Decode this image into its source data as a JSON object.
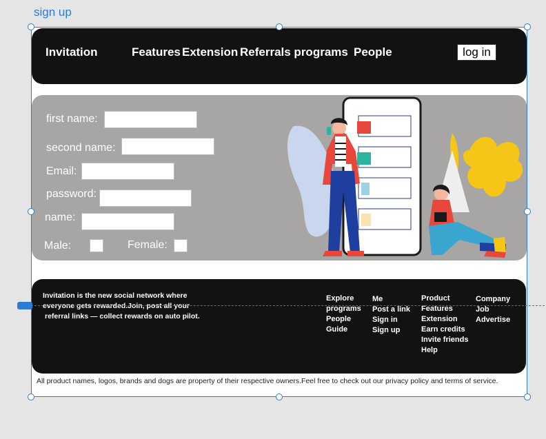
{
  "frame": {
    "label": "sign up"
  },
  "header": {
    "brand": "Invitation",
    "nav": [
      "Features",
      "Extension",
      "Referrals programs",
      "People"
    ],
    "login_label": "log in"
  },
  "form": {
    "first_name_label": "first name:",
    "second_name_label": "second name:",
    "email_label": "Email:",
    "password_label": "password:",
    "name_label": "name:",
    "male_label": "Male:",
    "female_label": "Female:"
  },
  "footer": {
    "about_lines": [
      "Invitation is the new social network where",
      "everyone gets rewarded.Join, post all your",
      "referral links — collect rewards on auto pilot."
    ],
    "col1": [
      "Explore",
      "programs",
      "People",
      "Guide"
    ],
    "col2": [
      "Me",
      "Post a link",
      "Sign in",
      "Sign up"
    ],
    "col3": [
      "Product",
      "Features",
      "Extension",
      "Earn credits",
      "Invite friends",
      "Help"
    ],
    "col4": [
      "Company",
      "Job",
      "Advertise"
    ]
  },
  "legal": "All product names, logos, brands and dogs are property of their respective owners.Feel free to check out our privacy policy and terms of service.",
  "colors": {
    "header_bg": "#121212",
    "hero_bg": "#a8a6a4",
    "selection": "#2b7cd3",
    "illustration_red": "#e8473b",
    "illustration_blue": "#1f3fa0",
    "illustration_yellow": "#f5c518",
    "illustration_teal": "#2bb5a0"
  }
}
